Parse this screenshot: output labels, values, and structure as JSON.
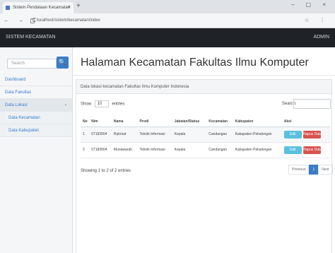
{
  "browser": {
    "tab_title": "Sistem Pendataan Kecamatan",
    "tab_close": "×",
    "new_tab": "+",
    "window_controls": "– ▢ ×",
    "nav_buttons": "← → C",
    "url": "localhost/sistem/kecamatan/index",
    "extensions": "☆ ⋮"
  },
  "app": {
    "brand": "SISTEM KECAMATAN",
    "user_label": "ADMIN"
  },
  "sidebar": {
    "search_placeholder": "Search",
    "search_button": "🔍",
    "items": [
      {
        "label": "Dashboard",
        "type": "main"
      },
      {
        "label": "Data Fakultas",
        "type": "main"
      },
      {
        "label": "Data Lokasi",
        "type": "main",
        "caret": "‹"
      },
      {
        "label": "Data Kecamatan",
        "type": "sub"
      },
      {
        "label": "Data Kabupaten",
        "type": "sub"
      }
    ]
  },
  "main": {
    "page_title": "Halaman Kecamatan Fakultas Ilmu Komputer",
    "panel_heading": "Data lokasi kecamatan Fakultas Ilmu Komputer Indonesia",
    "show_prefix": "Show",
    "show_value": "10",
    "show_suffix": "entries",
    "search_label": "Search:",
    "table": {
      "columns": [
        "No",
        "Nim",
        "Nama",
        "Prodi",
        "Jabatan/Status",
        "Kecamatan",
        "Kabupaten",
        "Aksi"
      ],
      "rows": [
        [
          "1",
          "07183904",
          "Rahmat",
          "Teknik Informasi",
          "Kepala",
          "Candangan",
          "Kabupaten Pekalongan"
        ],
        [
          "2",
          "07183904",
          "Munawarah",
          "Teknik Informasi",
          "Kepala",
          "Candangan",
          "Kabupaten Pekalongan"
        ]
      ],
      "edit_label": "Edit",
      "delete_label": "Hapus Data"
    },
    "info_text": "Showing 1 to 2 of 2 entries",
    "pager": {
      "previous": "Previous",
      "current": "1",
      "next": "Next"
    }
  }
}
